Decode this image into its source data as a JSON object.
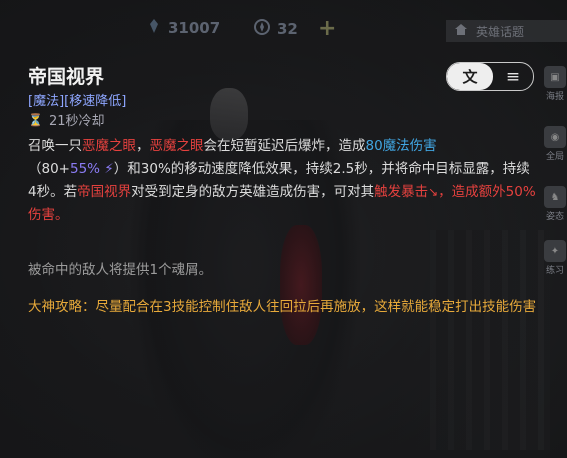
{
  "topbar": {
    "gems": "31007",
    "coins": "32",
    "home_label": "英雄话题"
  },
  "skill": {
    "name": "帝国视界",
    "tags": "[魔法][移速降低]",
    "cooldown": "21秒冷却"
  },
  "buttons": {
    "text_mode": "文",
    "menu_icon": "≡"
  },
  "side_menu": [
    "海报",
    "全局",
    "姿态",
    "练习"
  ],
  "description": {
    "p1": "召唤一只",
    "eye1": "恶魔之眼",
    "p2": "，",
    "eye2": "恶魔之眼",
    "p3": "会在短暂延迟后爆炸，造成",
    "dmg": "80魔法伤害",
    "p4": "（80+",
    "ratio": "55%",
    "p5": "）和30%的移动速度降低效果，持续2.5秒，并将命中目标显露，持续4秒。若",
    "skill_ref": "帝国视界",
    "p6": "对受到定身的敌方英雄造成伤害，可对其",
    "crit": "触发暴击",
    "crit2": "，造成额外50%伤害。"
  },
  "soul_text": "被命中的敌人将提供1个魂屑。",
  "tip": "大神攻略：尽量配合在3技能控制住敌人往回拉后再施放，这样就能稳定打出技能伤害",
  "colors": {
    "red": "#e5413e",
    "blue": "#41a5e1",
    "purple": "#8b7cf4",
    "tip": "#e7a93a"
  }
}
